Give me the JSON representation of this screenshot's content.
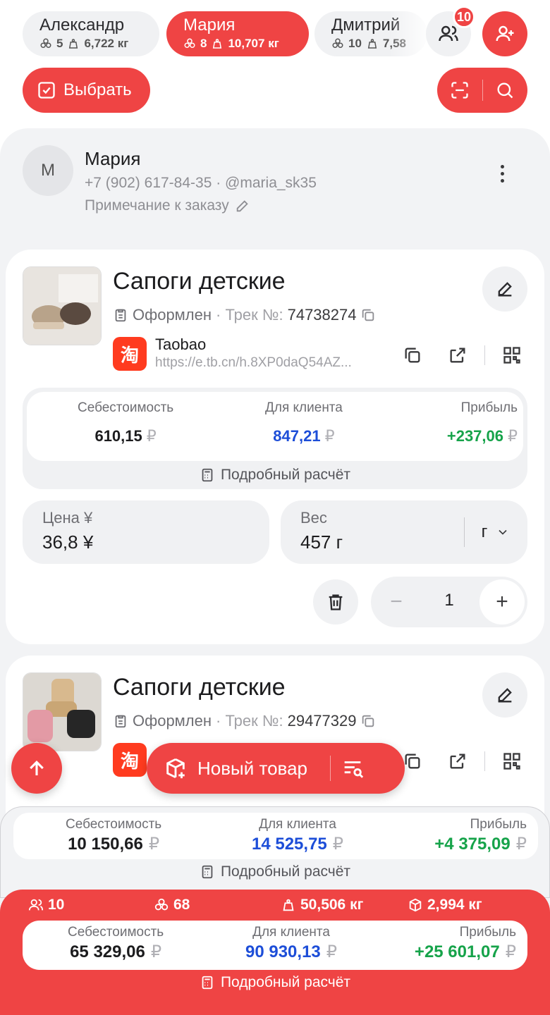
{
  "clients": [
    {
      "name": "Александр",
      "items": "5",
      "weight": "6,722 кг",
      "active": false
    },
    {
      "name": "Мария",
      "items": "8",
      "weight": "10,707 кг",
      "active": true
    },
    {
      "name": "Дмитрий",
      "items": "10",
      "weight": "7,58",
      "active": false
    }
  ],
  "notifications_count": "10",
  "toolbar": {
    "select_label": "Выбрать"
  },
  "order": {
    "avatar_letter": "М",
    "client_name": "Мария",
    "contact": "+7 (902) 617-84-35 · @maria_sk35",
    "note_placeholder": "Примечание к заказу"
  },
  "products": [
    {
      "title": "Сапоги детские",
      "status": "Оформлен",
      "track_label": "· Трек №:",
      "track": "74738274",
      "store_logo_text": "淘",
      "store_name": "Taobao",
      "store_url": "https://e.tb.cn/h.8XP0daQ54AZ...",
      "cost_label": "Себестоимость",
      "cost": "610,15",
      "client_label": "Для клиента",
      "client_price": "847,21",
      "profit_label": "Прибыль",
      "profit": "+237,06",
      "currency": "₽",
      "details_label": "Подробный расчёт",
      "price_label": "Цена ¥",
      "price_value": "36,8 ¥",
      "weight_label": "Вес",
      "weight_value": "457 г",
      "weight_unit": "г",
      "quantity": "1"
    },
    {
      "title": "Сапоги детские",
      "status": "Оформлен",
      "track_label": "· Трек №:",
      "track": "29477329",
      "store_logo_text": "淘"
    }
  ],
  "floating": {
    "new_item_label": "Новый товар"
  },
  "client_summary": {
    "cost_label": "Себестоимость",
    "cost": "10 150,66",
    "client_label": "Для клиента",
    "client_price": "14 525,75",
    "profit_label": "Прибыль",
    "profit": "+4 375,09",
    "currency": "₽",
    "details_label": "Подробный расчёт"
  },
  "total_summary": {
    "clients_count": "10",
    "items_count": "68",
    "gross_weight": "50,506 кг",
    "package_weight": "2,994 кг",
    "cost_label": "Себестоимость",
    "cost": "65 329,06",
    "client_label": "Для клиента",
    "client_price": "90 930,13",
    "profit_label": "Прибыль",
    "profit": "+25 601,07",
    "currency": "₽",
    "details_label": "Подробный расчёт"
  },
  "colors": {
    "accent": "#ef4444",
    "client_price": "#1d4ed8",
    "profit": "#16a34a",
    "background": "#f2f3f5"
  }
}
